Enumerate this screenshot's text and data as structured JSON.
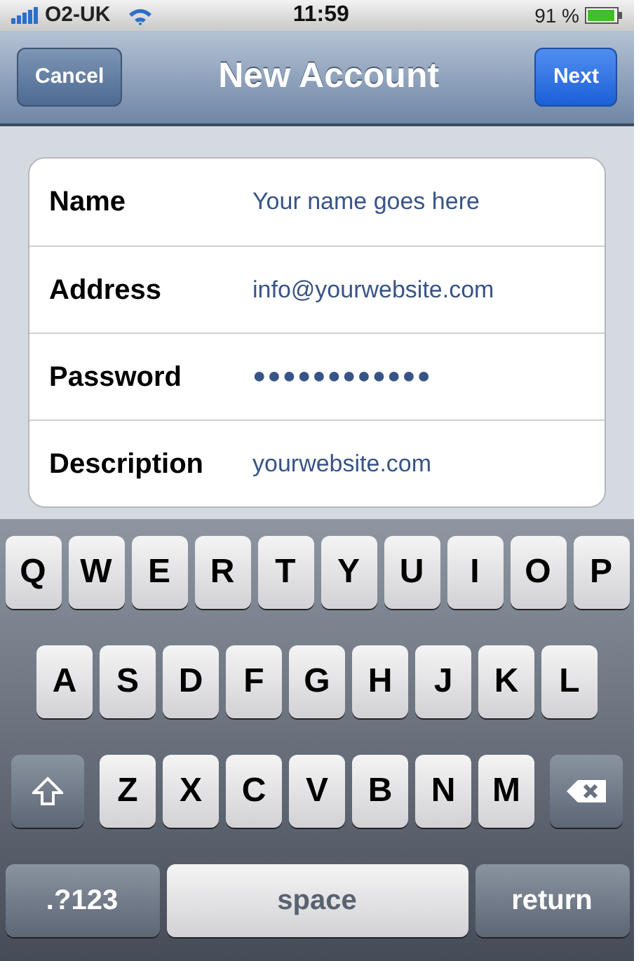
{
  "status_bar": {
    "carrier": "O2-UK",
    "time": "11:59",
    "battery": "91 %"
  },
  "nav_bar": {
    "title": "New Account",
    "left_button": "Cancel",
    "right_button": "Next"
  },
  "form": {
    "fields": [
      {
        "label": "Name",
        "value": "Your name goes here",
        "kind": "text"
      },
      {
        "label": "Address",
        "value": "info@yourwebsite.com",
        "kind": "text"
      },
      {
        "label": "Password",
        "value": "●●●●●●●●●●●●",
        "kind": "secret"
      },
      {
        "label": "Description",
        "value": "yourwebsite.com",
        "kind": "text"
      }
    ]
  },
  "keyboard": {
    "rows": [
      {
        "keys": [
          {
            "kind": "letter",
            "label": "Q"
          },
          {
            "kind": "letter",
            "label": "W"
          },
          {
            "kind": "letter",
            "label": "E"
          },
          {
            "kind": "letter",
            "label": "R"
          },
          {
            "kind": "letter",
            "label": "T"
          },
          {
            "kind": "letter",
            "label": "Y"
          },
          {
            "kind": "letter",
            "label": "U"
          },
          {
            "kind": "letter",
            "label": "I"
          },
          {
            "kind": "letter",
            "label": "O"
          },
          {
            "kind": "letter",
            "label": "P"
          }
        ]
      },
      {
        "keys": [
          {
            "kind": "letter",
            "label": "A"
          },
          {
            "kind": "letter",
            "label": "S"
          },
          {
            "kind": "letter",
            "label": "D"
          },
          {
            "kind": "letter",
            "label": "F"
          },
          {
            "kind": "letter",
            "label": "G"
          },
          {
            "kind": "letter",
            "label": "H"
          },
          {
            "kind": "letter",
            "label": "J"
          },
          {
            "kind": "letter",
            "label": "K"
          },
          {
            "kind": "letter",
            "label": "L"
          }
        ]
      },
      {
        "keys": [
          {
            "kind": "shift"
          },
          {
            "kind": "letter",
            "label": "Z"
          },
          {
            "kind": "letter",
            "label": "X"
          },
          {
            "kind": "letter",
            "label": "C"
          },
          {
            "kind": "letter",
            "label": "V"
          },
          {
            "kind": "letter",
            "label": "B"
          },
          {
            "kind": "letter",
            "label": "N"
          },
          {
            "kind": "letter",
            "label": "M"
          },
          {
            "kind": "delete"
          }
        ]
      },
      {
        "keys": [
          {
            "kind": "mode",
            "label": ".?123"
          },
          {
            "kind": "space",
            "label": "space"
          },
          {
            "kind": "mode",
            "label": "return"
          }
        ]
      }
    ]
  }
}
